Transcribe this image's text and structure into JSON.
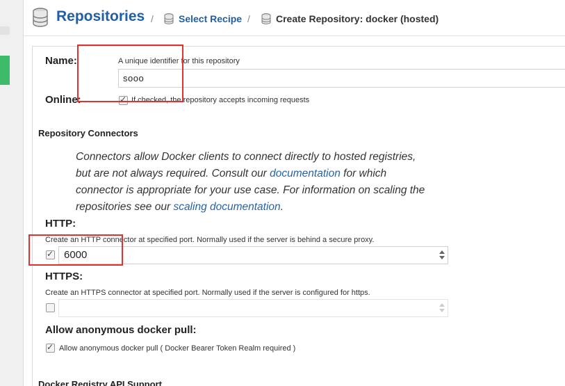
{
  "header": {
    "title": "Repositories",
    "separator": "/",
    "crumb_link": "Select Recipe",
    "crumb_current": "Create Repository: docker (hosted)"
  },
  "form": {
    "name_label": "Name:",
    "name_help": "A unique identifier for this repository",
    "name_value": "sooo",
    "online_label": "Online:",
    "online_help": "If checked, the repository accepts incoming requests",
    "online_checked": true
  },
  "connectors": {
    "section_title": "Repository Connectors",
    "desc_part1": "Connectors allow Docker clients to connect directly to hosted registries, but are not always required. Consult our ",
    "desc_link1": "documentation",
    "desc_part2": " for which connector is appropriate for your use case. For information on scaling the repositories see our ",
    "desc_link2": "scaling documentation",
    "desc_part3": ".",
    "http_label": "HTTP:",
    "http_help": "Create an HTTP connector at specified port. Normally used if the server is behind a secure proxy.",
    "http_checked": true,
    "http_port": "6000",
    "https_label": "HTTPS:",
    "https_help": "Create an HTTPS connector at specified port. Normally used if the server is configured for https.",
    "https_checked": false,
    "https_port": "",
    "anon_label": "Allow anonymous docker pull:",
    "anon_help": "Allow anonymous docker pull ( Docker Bearer Token Realm required )",
    "anon_checked": true
  },
  "next_section_title": "Docker Registry API Support",
  "colors": {
    "accent": "#1f5fa8",
    "sidebar_active": "#3dbb6b",
    "annotation": "#e03030"
  }
}
